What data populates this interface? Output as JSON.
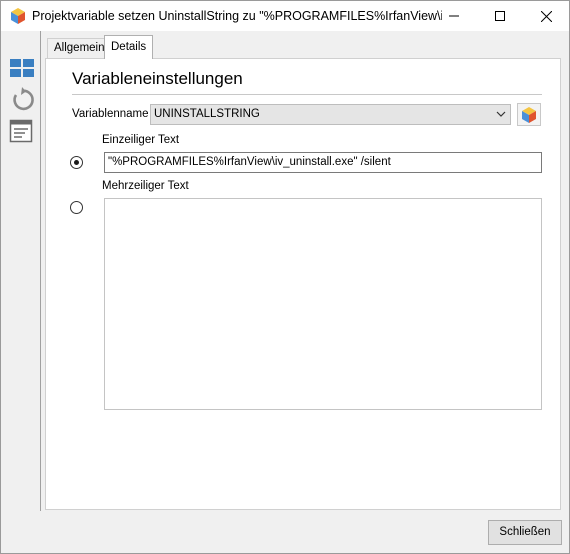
{
  "window": {
    "title": "Projektvariable setzen UninstallString zu \"%PROGRAMFILES%IrfanView\\iv_...",
    "controls": {
      "minimize_icon": "minimize-icon",
      "maximize_icon": "maximize-icon",
      "close_icon": "close-icon"
    }
  },
  "toolbar": {
    "items": [
      {
        "icon": "layout-grid-icon"
      },
      {
        "icon": "refresh-icon"
      },
      {
        "icon": "properties-list-icon"
      }
    ]
  },
  "tabs": [
    {
      "label": "Allgemein",
      "active": false
    },
    {
      "label": "Details",
      "active": true
    }
  ],
  "section": {
    "title": "Variableneinstellungen"
  },
  "variable": {
    "label": "Variablenname",
    "selected": "UNINSTALLSTRING",
    "picker_icon": "variable-picker-icon"
  },
  "single_line": {
    "label": "Einzeiliger Text",
    "value": "\"%PROGRAMFILES%IrfanView\\iv_uninstall.exe\" /silent",
    "selected": true
  },
  "multi_line": {
    "label": "Mehrzeiliger Text",
    "value": "",
    "selected": false
  },
  "footer": {
    "close_label": "Schließen"
  },
  "colors": {
    "window_bg": "#f0f0f0",
    "panel_bg": "#ffffff",
    "toolbar_blue": "#3a7fc1",
    "icon_gray": "#8a8a8a"
  }
}
